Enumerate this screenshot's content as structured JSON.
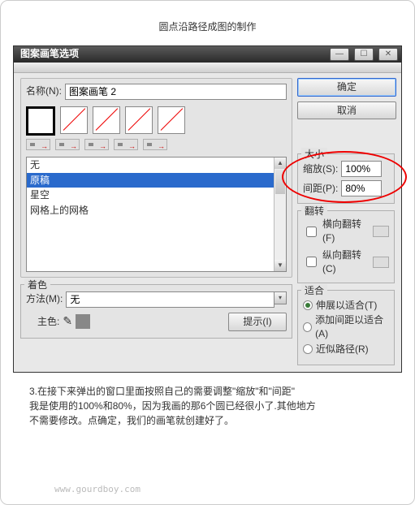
{
  "page_title": "圆点沿路径成图的制作",
  "window": {
    "title": "图案画笔选项"
  },
  "name": {
    "label": "名称(N):",
    "value": "图案画笔 2"
  },
  "buttons": {
    "ok": "确定",
    "cancel": "取消",
    "tip": "提示(I)"
  },
  "list": {
    "items": [
      "无",
      "原稿",
      "星空",
      "网格上的网格"
    ],
    "selected_index": 1
  },
  "size": {
    "title": "大小",
    "scale_label": "缩放(S):",
    "scale_value": "100%",
    "spacing_label": "间距(P):",
    "spacing_value": "80%"
  },
  "flip": {
    "title": "翻转",
    "h": "横向翻转(F)",
    "v": "纵向翻转(C)"
  },
  "tint": {
    "title": "着色",
    "method_label": "方法(M):",
    "method_value": "无",
    "keycolor_label": "主色:"
  },
  "fit": {
    "title": "适合",
    "stretch": "伸展以适合(T)",
    "addspace": "添加间距以适合(A)",
    "approx": "近似路径(R)",
    "selected": 0
  },
  "caption": {
    "line1": "3.在接下来弹出的窗口里面按照自己的需要调整\"缩放\"和\"间距\"",
    "line2": "我是使用的100%和80%，因为我画的那6个圆已经很小了.其他地方",
    "line3": "不需要修改。点确定，我们的画笔就创建好了。"
  },
  "watermark": "www.gourdboy.com"
}
